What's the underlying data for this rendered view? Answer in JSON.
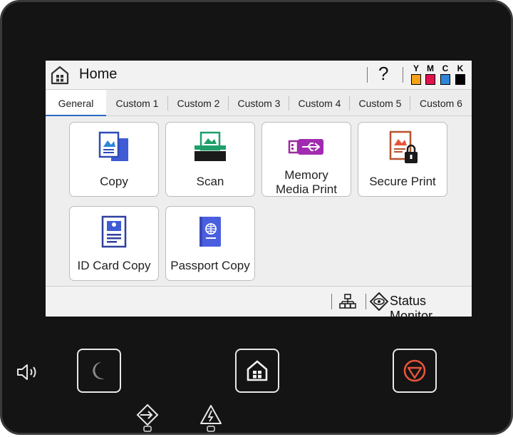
{
  "header": {
    "title": "Home",
    "help_label": "?"
  },
  "ink_levels": [
    {
      "label": "Y",
      "color": "#f6a11a"
    },
    {
      "label": "M",
      "color": "#e0134d"
    },
    {
      "label": "C",
      "color": "#2f86d9"
    },
    {
      "label": "K",
      "color": "#000000"
    }
  ],
  "tabs": [
    {
      "label": "General",
      "selected": true
    },
    {
      "label": "Custom 1"
    },
    {
      "label": "Custom 2"
    },
    {
      "label": "Custom 3"
    },
    {
      "label": "Custom 4"
    },
    {
      "label": "Custom 5"
    },
    {
      "label": "Custom 6"
    }
  ],
  "tiles": [
    {
      "label": "Copy",
      "icon": "copy-icon"
    },
    {
      "label": "Scan",
      "icon": "scan-icon"
    },
    {
      "label_line1": "Memory",
      "label_line2": "Media Print",
      "icon": "usb-icon"
    },
    {
      "label": "Secure Print",
      "icon": "secure-print-icon"
    },
    {
      "label": "ID Card Copy",
      "icon": "id-card-icon"
    },
    {
      "label": "Passport Copy",
      "icon": "passport-icon"
    }
  ],
  "status_bar": {
    "status_monitor_label": "Status Monitor",
    "network_icon": "network-icon",
    "status_icon": "eye-icon"
  },
  "hardware": {
    "sleep_icon": "moon-icon",
    "home_icon": "home-icon",
    "stop_icon": "stop-icon",
    "sound_icon": "speaker-icon",
    "data_icon": "data-in-icon",
    "error_icon": "warning-icon"
  },
  "colors": {
    "accent": "#2b6cc4",
    "stop": "#e8553a",
    "bezel": "#141414"
  }
}
